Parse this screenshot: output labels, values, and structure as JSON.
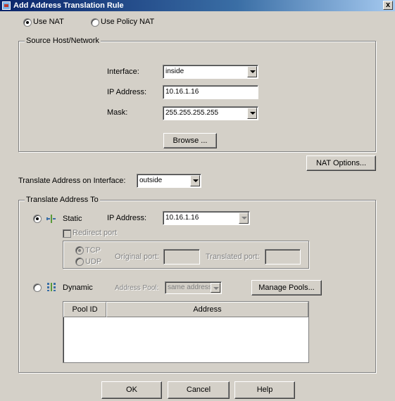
{
  "window": {
    "title": "Add Address Translation Rule",
    "close_label": "x"
  },
  "mode": {
    "use_nat": {
      "label": "Use NAT",
      "checked": true
    },
    "use_policy_nat": {
      "label": "Use Policy NAT",
      "checked": false
    }
  },
  "source": {
    "group_label": "Source Host/Network",
    "interface_label": "Interface:",
    "interface_value": "inside",
    "ip_label": "IP Address:",
    "ip_value": "10.16.1.16",
    "mask_label": "Mask:",
    "mask_value": "255.255.255.255",
    "browse_label": "Browse ..."
  },
  "nat_options_label": "NAT Options...",
  "translate_interface": {
    "label": "Translate Address on Interface:",
    "value": "outside"
  },
  "translate_to": {
    "group_label": "Translate Address To",
    "static": {
      "label": "Static",
      "checked": true,
      "ip_label": "IP Address:",
      "ip_value": "10.16.1.16",
      "redirect_label": "Redirect port",
      "tcp_label": "TCP",
      "udp_label": "UDP",
      "original_port_label": "Original port:",
      "translated_port_label": "Translated port:",
      "original_port_value": "",
      "translated_port_value": ""
    },
    "dynamic": {
      "label": "Dynamic",
      "checked": false,
      "pool_label": "Address Pool:",
      "pool_value": "same address",
      "manage_label": "Manage Pools..."
    },
    "pool_table": {
      "columns": [
        "Pool ID",
        "Address"
      ],
      "rows": []
    }
  },
  "buttons": {
    "ok": "OK",
    "cancel": "Cancel",
    "help": "Help"
  },
  "icons": {
    "static": "static-nat-icon",
    "dynamic": "dynamic-nat-icon"
  }
}
